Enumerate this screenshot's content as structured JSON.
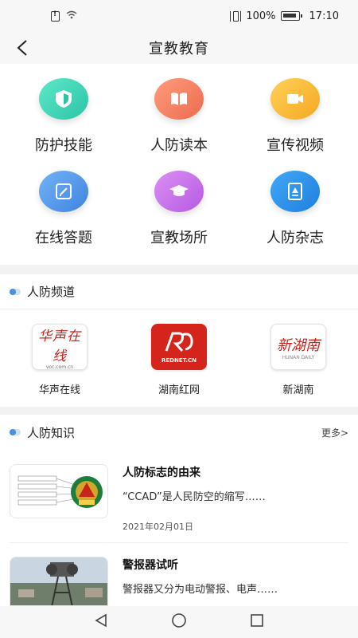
{
  "status_bar": {
    "battery": "100%",
    "time": "17:10"
  },
  "header": {
    "title": "宣教教育"
  },
  "grid": [
    {
      "label": "防护技能",
      "icon": "shield-icon",
      "color": "#3ed2b6"
    },
    {
      "label": "人防读本",
      "icon": "book-icon",
      "color": "#f07a5c"
    },
    {
      "label": "宣传视频",
      "icon": "video-icon",
      "color": "#f9b82f"
    },
    {
      "label": "在线答题",
      "icon": "edit-icon",
      "color": "#4b92e8"
    },
    {
      "label": "宣教场所",
      "icon": "graduation-cap-icon",
      "color": "#c36de7"
    },
    {
      "label": "人防杂志",
      "icon": "magazine-icon",
      "color": "#2f8fe8"
    }
  ],
  "channels_section": {
    "title": "人防频道",
    "items": [
      {
        "label": "华声在线",
        "logo": "华声在线",
        "icon": "huasheng-logo"
      },
      {
        "label": "湖南红网",
        "logo": "REDNET.CN",
        "icon": "rednet-logo"
      },
      {
        "label": "新湖南",
        "logo": "新湖南",
        "logo_sub": "HUNAN DAILY",
        "icon": "xinhunan-logo"
      }
    ]
  },
  "knowledge_section": {
    "title": "人防知识",
    "more": "更多>",
    "articles": [
      {
        "title": "人防标志的由来",
        "desc": "“CCAD”是人民防空的缩写……",
        "date": "2021年02月01日"
      },
      {
        "title": "警报器试听",
        "desc": "警报器又分为电动警报、电声……"
      }
    ]
  },
  "colors": {
    "accent_blue": "#4a8fe0",
    "section_bg": "#f2f2f2"
  }
}
